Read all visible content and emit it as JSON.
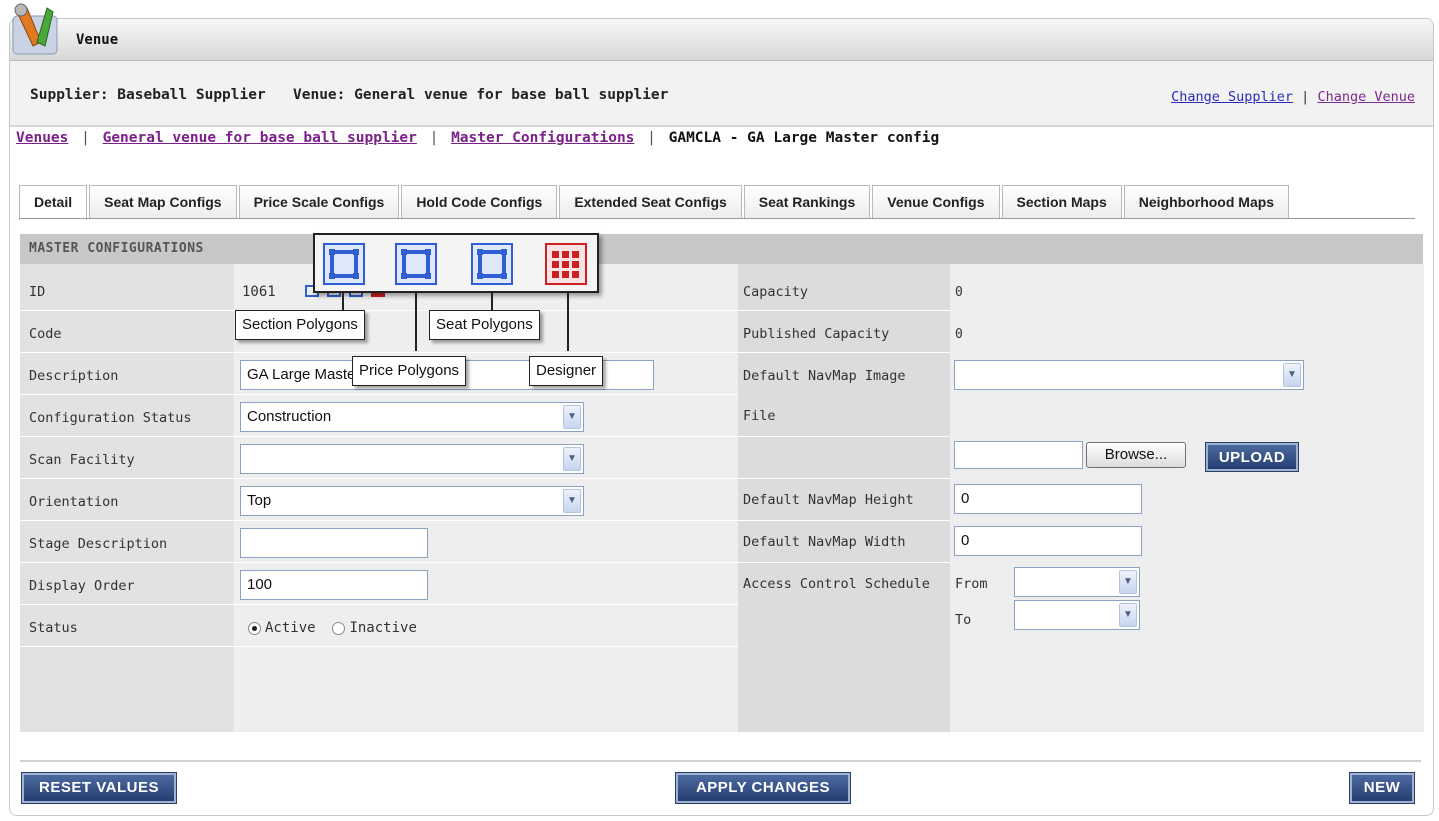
{
  "window": {
    "title": "Venue",
    "icon": "tools-icon"
  },
  "context": {
    "supplier": "Supplier: Baseball Supplier",
    "venue": "Venue: General venue for base ball supplier",
    "change_supplier": "Change Supplier",
    "link_separator": "|",
    "change_venue": "Change Venue"
  },
  "breadcrumb": {
    "venues": "Venues",
    "venue": "General venue for base ball supplier",
    "master": "Master Configurations",
    "current": "GAMCLA - GA Large Master config",
    "separator": "|"
  },
  "tabs": [
    {
      "label": "Detail"
    },
    {
      "label": "Seat Map Configs"
    },
    {
      "label": "Price Scale Configs"
    },
    {
      "label": "Hold Code Configs"
    },
    {
      "label": "Extended Seat Configs"
    },
    {
      "label": "Seat Rankings"
    },
    {
      "label": "Venue Configs"
    },
    {
      "label": "Section Maps"
    },
    {
      "label": "Neighborhood Maps"
    }
  ],
  "section_title": "MASTER CONFIGURATIONS",
  "left": {
    "id_label": "ID",
    "id_value": "1061",
    "code_label": "Code",
    "description_label": "Description",
    "description_value": "GA Large Master config",
    "config_status_label": "Configuration Status",
    "config_status_value": "Construction",
    "scan_facility_label": "Scan Facility",
    "scan_facility_value": "",
    "orientation_label": "Orientation",
    "orientation_value": "Top",
    "stage_description_label": "Stage Description",
    "stage_description_value": "",
    "display_order_label": "Display Order",
    "display_order_value": "100",
    "status_label": "Status",
    "status_active": "Active",
    "status_inactive": "Inactive"
  },
  "right": {
    "capacity_label": "Capacity",
    "capacity_value": "0",
    "published_capacity_label": "Published Capacity",
    "published_capacity_value": "0",
    "navmap_image_label": "Default NavMap Image",
    "file_label": "File",
    "browse_label": "Browse...",
    "upload_label": "UPLOAD",
    "navmap_height_label": "Default NavMap Height",
    "navmap_height_value": "0",
    "navmap_width_label": "Default NavMap Width",
    "navmap_width_value": "0",
    "access_control_label": "Access Control Schedule",
    "from_label": "From",
    "to_label": "To"
  },
  "tooltips": {
    "section_polygons": "Section Polygons",
    "seat_polygons": "Seat Polygons",
    "price_polygons": "Price Polygons",
    "designer": "Designer"
  },
  "actions": {
    "reset": "RESET VALUES",
    "apply": "APPLY CHANGES",
    "new": "NEW"
  },
  "colors": {
    "accent": "#2b3f66",
    "link": "#7b1f8a",
    "icon_blue": "#2f5fd3",
    "icon_red": "#cc1f1f"
  }
}
